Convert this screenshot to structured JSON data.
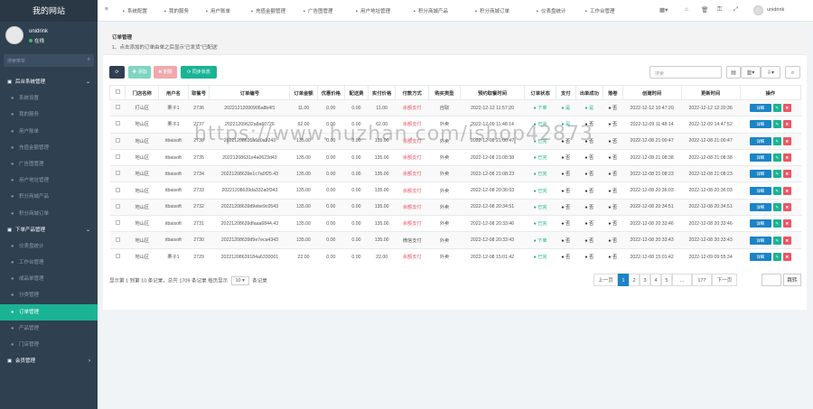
{
  "app": {
    "title": "我的网站"
  },
  "user": {
    "name": "unidrink",
    "status": "在线"
  },
  "sidebar": {
    "search_placeholder": "搜索菜单",
    "items": [
      {
        "label": "后台系统管理",
        "type": "group",
        "caret": "⌄"
      },
      {
        "label": "系统设置",
        "type": "sub"
      },
      {
        "label": "我的服务",
        "type": "sub"
      },
      {
        "label": "用户账单",
        "type": "sub"
      },
      {
        "label": "充值金额管理",
        "type": "sub"
      },
      {
        "label": "广告图管理",
        "type": "sub"
      },
      {
        "label": "用户地址管理",
        "type": "sub"
      },
      {
        "label": "积分商城产品",
        "type": "sub"
      },
      {
        "label": "积分商城订单",
        "type": "sub"
      },
      {
        "label": "下单产品管理",
        "type": "group",
        "caret": "⌄"
      },
      {
        "label": "仪表盘统计",
        "type": "sub"
      },
      {
        "label": "工作台管理",
        "type": "sub"
      },
      {
        "label": "成品单管理",
        "type": "sub"
      },
      {
        "label": "分类管理",
        "type": "sub"
      },
      {
        "label": "订单管理",
        "type": "sub",
        "active": true
      },
      {
        "label": "产品管理",
        "type": "sub"
      },
      {
        "label": "门店管理",
        "type": "sub"
      },
      {
        "label": "会员管理",
        "type": "group",
        "caret": "›"
      }
    ]
  },
  "topnav": {
    "items": [
      "系统配置",
      "我的服务",
      "用户账单",
      "充值金额管理",
      "广告图管理",
      "用户地址管理",
      "积分商城产品",
      "积分商城订单",
      "仪表盘统计",
      "工作台管理"
    ],
    "user": "unidrink"
  },
  "notice": {
    "title": "订单管理",
    "desc": "1、点击添加的订单由单之后显示'已发货''已配送'"
  },
  "toolbar": {
    "add": "添加",
    "delete": "删除",
    "sync": "同步状态",
    "search_placeholder": "搜索"
  },
  "table": {
    "headers": [
      "",
      "门店名称",
      "用户名",
      "取餐号",
      "订单编号",
      "订单金额",
      "优惠价格",
      "配送费",
      "实付价格",
      "付款方式",
      "购买类型",
      "预约取餐时间",
      "订单状态",
      "支付",
      "出单成功",
      "落卷",
      "创建时间",
      "更新时间",
      "操作"
    ],
    "rows": [
      [
        "打山区",
        "栗子1",
        "2736",
        "20221212090906a8b4f1",
        "11.00",
        "0.00",
        "0.00",
        "11.00",
        "余额支付",
        "自取",
        "2022-12-12 11:57:20",
        "下单",
        "是",
        "是",
        "否",
        "2022-12-12 10:47:20",
        "2022-12-12 12:20:36"
      ],
      [
        "地山区",
        "栗子1",
        "2737",
        "20221209632a8a60726",
        "62.00",
        "0.00",
        "0.00",
        "62.00",
        "余额支付",
        "外卖",
        "2022-12-09 11:48:14",
        "已完",
        "是",
        "否",
        "否",
        "2022-12-09 11:48:14",
        "2022-12-09 14:47:52"
      ],
      [
        "地山区",
        "itbaisoft",
        "2738",
        "20221208635a6c0a9243",
        "135.00",
        "0.00",
        "0.00",
        "135.00",
        "余额支付",
        "外卖",
        "2022-12-08 21:00:47",
        "已完",
        "否",
        "否",
        "否",
        "2022-12-08 21:00:47",
        "2022-12-08 21:00:47"
      ],
      [
        "地山区",
        "itbaisoft",
        "2735",
        "20221208631e4a0623d43",
        "135.00",
        "0.00",
        "0.00",
        "135.00",
        "余额支付",
        "外卖",
        "2022-12-08 21:08:38",
        "已完",
        "否",
        "否",
        "否",
        "2022-12-08 21:08:38",
        "2022-12-08 21:08:38"
      ],
      [
        "地山区",
        "itbaisoft",
        "2734",
        "20221208639e1c7a0f25.43",
        "135.00",
        "0.00",
        "0.00",
        "135.00",
        "余额支付",
        "外卖",
        "2022-12-08 21:08:23",
        "已完",
        "否",
        "否",
        "否",
        "2022-12-08 21:08:23",
        "2022-12-08 21:08:23"
      ],
      [
        "地山区",
        "itbaisoft",
        "2733",
        "20221208639da332a0f343",
        "135.00",
        "0.00",
        "0.00",
        "135.00",
        "余额支付",
        "外卖",
        "2022-12-08 20:36:03",
        "已完",
        "否",
        "否",
        "否",
        "2022-12-08 20:36:03",
        "2022-12-08 20:36:03"
      ],
      [
        "地山区",
        "itbaisoft",
        "2732",
        "20221208639d9ebe9c0543",
        "135.00",
        "0.00",
        "0.00",
        "135.00",
        "余额支付",
        "外卖",
        "2022-12-08 20:34:51",
        "已完",
        "否",
        "否",
        "否",
        "2022-12-08 20:34:51",
        "2022-12-08 20:34:51"
      ],
      [
        "地山区",
        "itbaisoft",
        "2731",
        "20221208639dfaaa6844.43",
        "135.00",
        "0.00",
        "0.00",
        "135.00",
        "余额支付",
        "外卖",
        "2022-12-08 20:33:46",
        "已完",
        "否",
        "否",
        "否",
        "2022-12-08 20:33:46",
        "2022-12-08 20:33:46"
      ],
      [
        "地山区",
        "itbaisoft",
        "2730",
        "20221208639d9e7eca4343",
        "135.00",
        "0.00",
        "0.00",
        "135.00",
        "微信支付",
        "外卖",
        "2022-12-08 20:33:43",
        "下单",
        "否",
        "否",
        "否",
        "2022-12-08 20:33:43",
        "2022-12-08 20:33:43"
      ],
      [
        "地山区",
        "栗子1",
        "2729",
        "20221208639184a6330001",
        "22.00",
        "0.00",
        "0.00",
        "22.00",
        "余额支付",
        "外卖",
        "2022-12-08 15:01:42",
        "已完",
        "否",
        "否",
        "否",
        "2022-12-08 15:01:42",
        "2022-12-09 09:55:34"
      ]
    ],
    "op_view": "详细",
    "op_edit": "✎",
    "op_delete": "✖"
  },
  "footer": {
    "info_a": "显示第 1 到第 10 条记录，总共 1709 条记录 每页显示",
    "page_size": "10 ▾",
    "info_b": "条记录",
    "prev": "上一页",
    "pages": [
      "1",
      "2",
      "3",
      "4",
      "5",
      "...",
      "177"
    ],
    "next": "下一页",
    "jump": "跳转"
  },
  "watermark": "https://www.huzhan.com/ishop42873"
}
